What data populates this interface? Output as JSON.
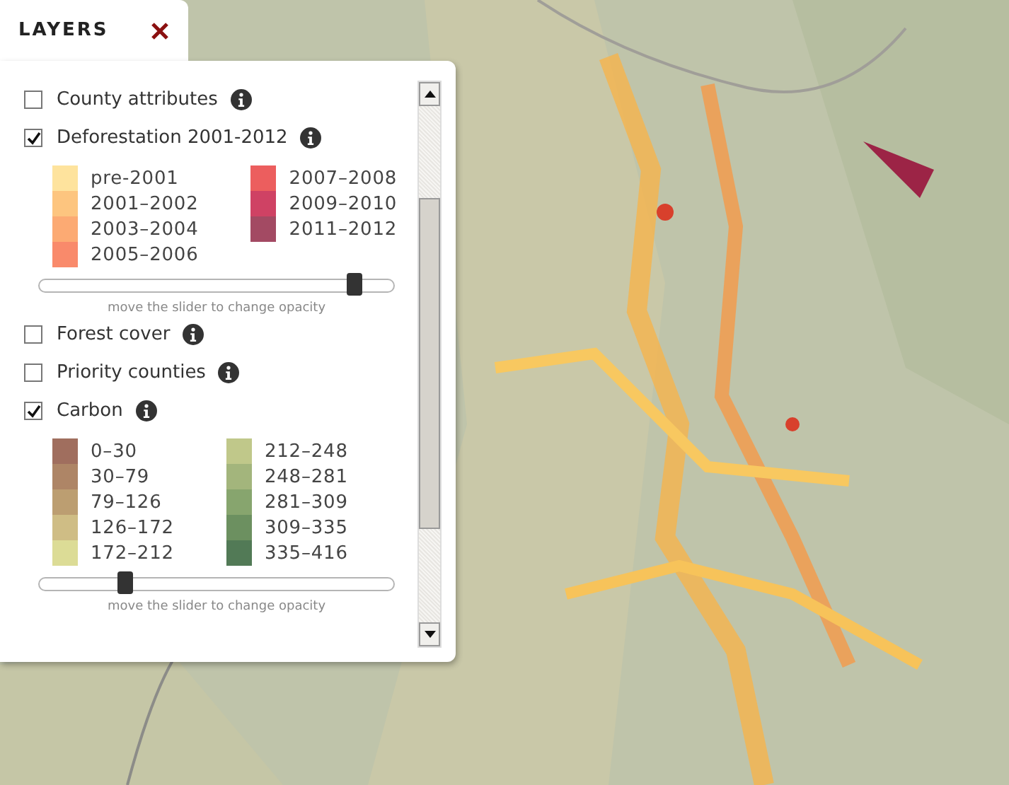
{
  "tab": {
    "title": "LAYERS"
  },
  "layers": [
    {
      "kind": "plain",
      "name": "County attributes",
      "checked": false
    },
    {
      "kind": "legend",
      "name": "Deforestation 2001-2012",
      "checked": true,
      "legend": [
        [
          {
            "label": "pre-2001",
            "color": "#fee39d"
          },
          {
            "label": "2001–2002",
            "color": "#fdc57f"
          },
          {
            "label": "2003–2004",
            "color": "#fcaa73"
          },
          {
            "label": "2005–2006",
            "color": "#f98a6b"
          }
        ],
        [
          {
            "label": "2007–2008",
            "color": "#ec5e5e"
          },
          {
            "label": "2009–2010",
            "color": "#cf4264"
          },
          {
            "label": "2011–2012",
            "color": "#a34a63"
          }
        ]
      ],
      "opacity": {
        "level": 0.89,
        "hint": "move the slider to change opacity"
      }
    },
    {
      "kind": "plain",
      "name": "Forest cover",
      "checked": false
    },
    {
      "kind": "plain",
      "name": "Priority counties",
      "checked": false
    },
    {
      "kind": "legend",
      "name": "Carbon",
      "checked": true,
      "legend": [
        [
          {
            "label": "0–30",
            "color": "#a06e5e"
          },
          {
            "label": "30–79",
            "color": "#ae8566"
          },
          {
            "label": "79–126",
            "color": "#bc9e71"
          },
          {
            "label": "126–172",
            "color": "#cfbd85"
          },
          {
            "label": "172–212",
            "color": "#dcdc96"
          }
        ],
        [
          {
            "label": "212–248",
            "color": "#c0c88a"
          },
          {
            "label": "248–281",
            "color": "#a3b57c"
          },
          {
            "label": "281–309",
            "color": "#87a56e"
          },
          {
            "label": "309–335",
            "color": "#6c9060"
          },
          {
            "label": "335–416",
            "color": "#527a56"
          }
        ]
      ],
      "opacity": {
        "level": 0.245,
        "hint": "move the slider to change opacity"
      }
    }
  ]
}
